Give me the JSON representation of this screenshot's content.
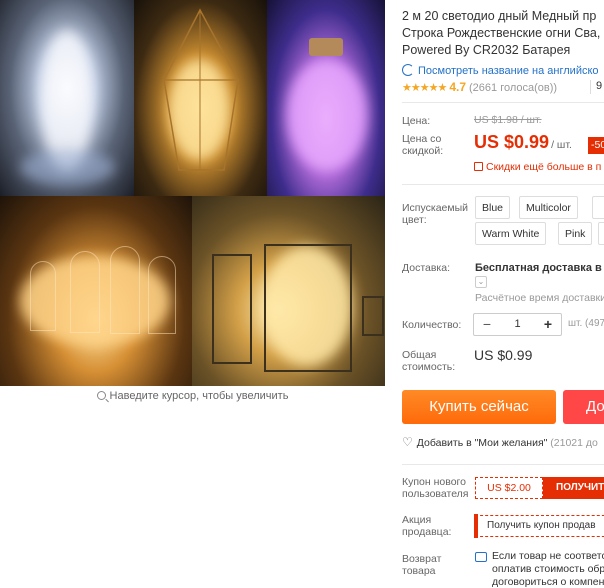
{
  "gallery": {
    "zoom_hint": "Наведите курсор, чтобы увеличить",
    "images": [
      "copper-wire-lights-in-glass-cylinder",
      "lights-in-geometric-terrarium",
      "colored-lights-in-jar",
      "lights-in-glass-domes",
      "lights-in-lanterns"
    ]
  },
  "product": {
    "title_lines": [
      "2 м 20 светодио дный Медный пр",
      "Строка Рождественские огни Сва,",
      "Powered By CR2032 Батарея"
    ],
    "translate_link": "Посмотреть название на английско",
    "rating": {
      "stars": "★★★★★",
      "value": "4.7",
      "votes": "(2661 голоса(ов))",
      "orders_partial": "9"
    }
  },
  "price": {
    "label": "Цена:",
    "old": "US $1.98 / шт.",
    "discount_label": "Цена со скидкой:",
    "new": "US $0.99",
    "per_unit": "/ шт.",
    "discount_badge": "-50",
    "bulk_note": "Скидки ещё больше в п"
  },
  "color": {
    "label": "Испускаемый цвет:",
    "options": [
      "Blue",
      "Multicolor",
      "",
      "Warm White",
      "Pink",
      ""
    ]
  },
  "shipping": {
    "label": "Доставка:",
    "value": "Бесплатная доставка в Ru",
    "estimate": "Расчётное время доставки"
  },
  "quantity": {
    "label": "Количество:",
    "minus": "−",
    "value": "1",
    "plus": "+",
    "unit": "шт. (497"
  },
  "total": {
    "label": "Общая стоимость:",
    "value": "US $0.99"
  },
  "actions": {
    "buy_now": "Купить сейчас",
    "add_to_cart": "До"
  },
  "wishlist": {
    "label": "Добавить в \"Мои желания\"",
    "count": "(21021 до"
  },
  "coupons": {
    "new_user_label": "Купон нового пользователя",
    "new_user_value": "US $2.00",
    "new_user_action": "ПОЛУЧИТЬ",
    "seller_label": "Акция продавца:",
    "seller_action": "Получить купон продав"
  },
  "returns": {
    "label": "Возврат товара",
    "text_lines": [
      "Если товар не соответс",
      "оплатив стоимость обр",
      "договориться о компен"
    ]
  },
  "colors": {
    "accent": "#e62e04",
    "buy": "#ff7a18",
    "cart": "#ff4747",
    "link": "#2371c8",
    "star": "#f5a623"
  }
}
